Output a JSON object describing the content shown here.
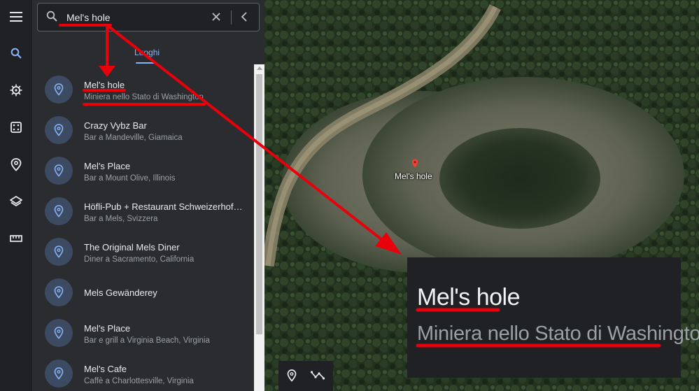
{
  "search": {
    "query": "Mel's hole"
  },
  "tabs": [
    {
      "label": "Luoghi"
    }
  ],
  "results": [
    {
      "name": "Mel's hole",
      "subtitle": "Miniera nello Stato di Washington"
    },
    {
      "name": "Crazy Vybz Bar",
      "subtitle": "Bar a Mandeville, Giamaica"
    },
    {
      "name": "Mel's Place",
      "subtitle": "Bar a Mount Olive, Illinois"
    },
    {
      "name": "Höfli-Pub + Restaurant Schweizerhof…",
      "subtitle": "Bar a Mels, Svizzera"
    },
    {
      "name": "The Original Mels Diner",
      "subtitle": "Diner a Sacramento, California"
    },
    {
      "name": "Mels Gewänderey",
      "subtitle": ""
    },
    {
      "name": "Mel's Place",
      "subtitle": "Bar e grill a Virginia Beach, Virginia"
    },
    {
      "name": "Mel's Cafe",
      "subtitle": "Caffè a Charlottesville, Virginia"
    }
  ],
  "map": {
    "place_label": "Mel's hole"
  },
  "zoom_callout": {
    "title": "Mel's hole",
    "subtitle": "Miniera nello Stato di Washington"
  },
  "rail_icons": [
    "menu-icon",
    "search-icon",
    "voyager-icon",
    "dice-icon",
    "pin-icon",
    "layers-icon",
    "ruler-icon"
  ],
  "colors": {
    "accent": "#8ab4f8",
    "annotation": "#e8000b",
    "pin": "#ea4335"
  }
}
